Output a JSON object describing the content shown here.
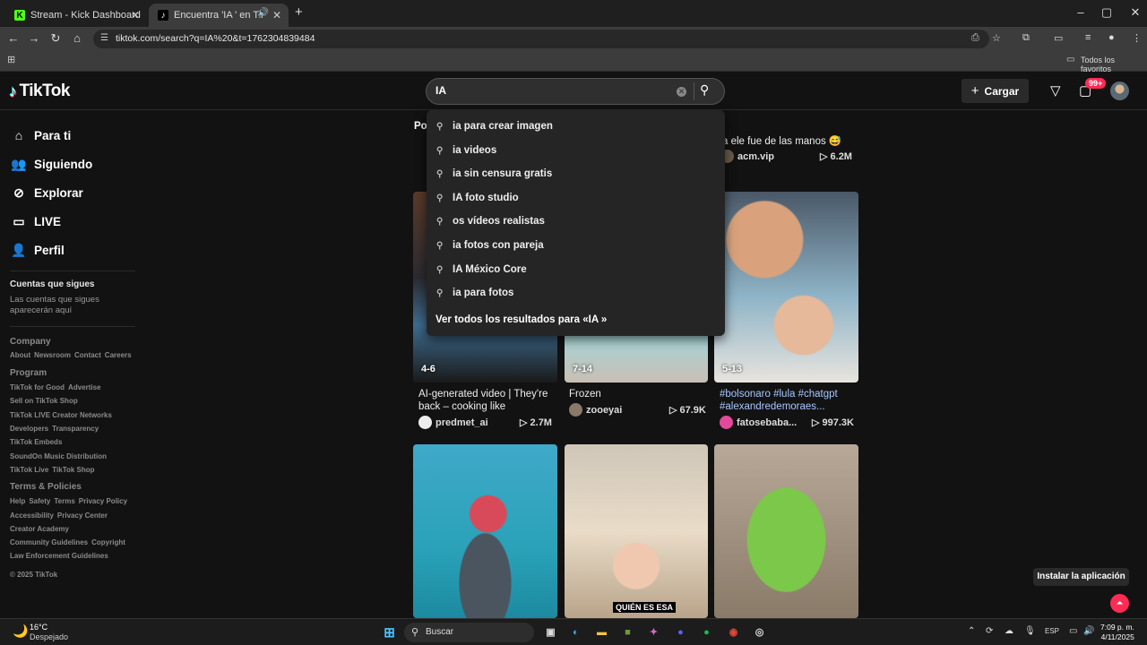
{
  "browser": {
    "tabs": [
      {
        "label": "Stream - Kick Dashboard",
        "favicon": "K"
      },
      {
        "label": "Encuentra 'IA ' en TikTok | B",
        "favicon": "♪"
      }
    ],
    "url": "tiktok.com/search?q=IA%20&t=1762304839484",
    "bookmarks_label": "Todos los favoritos"
  },
  "header": {
    "logo": "TikTok",
    "search_value": "IA",
    "upload_label": "Cargar",
    "inbox_badge": "99+"
  },
  "sidebar": {
    "nav": [
      {
        "label": "Para ti",
        "icon": "home-icon"
      },
      {
        "label": "Siguiendo",
        "icon": "following-icon"
      },
      {
        "label": "Explorar",
        "icon": "compass-icon"
      },
      {
        "label": "LIVE",
        "icon": "live-icon"
      },
      {
        "label": "Perfil",
        "icon": "profile-icon"
      }
    ],
    "following_title": "Cuentas que sigues",
    "following_text": "Las cuentas que sigues aparecerán aquí",
    "company_title": "Company",
    "company_links": [
      "About",
      "Newsroom",
      "Contact",
      "Careers"
    ],
    "program_title": "Program",
    "program_rows": [
      [
        "TikTok for Good",
        "Advertise"
      ],
      [
        "Sell on TikTok Shop"
      ],
      [
        "TikTok LIVE Creator Networks"
      ],
      [
        "Developers",
        "Transparency"
      ],
      [
        "TikTok Embeds"
      ],
      [
        "SoundOn Music Distribution"
      ],
      [
        "TikTok Live",
        "TikTok Shop"
      ]
    ],
    "terms_title": "Terms & Policies",
    "terms_rows": [
      [
        "Help",
        "Safety",
        "Terms",
        "Privacy Policy"
      ],
      [
        "Accessibility",
        "Privacy Center"
      ],
      [
        "Creator Academy"
      ],
      [
        "Community Guidelines",
        "Copyright"
      ],
      [
        "Law Enforcement Guidelines"
      ]
    ],
    "copyright": "© 2025 TikTok"
  },
  "suggestions": {
    "items": [
      "ia para crear imagen",
      "ia videos",
      "ia sin censura gratis",
      "IA foto studio",
      "os vídeos realistas",
      "ia fotos con pareja",
      "IA México Core",
      "ia para fotos"
    ],
    "see_all": "Ver todos los resultados para «IA »"
  },
  "videos": {
    "top_partial": {
      "left_caption_fragment": "Po",
      "right_caption": "a ele fue de las manos 😅",
      "right_author": "acm.vip",
      "right_views": "6.2M"
    },
    "row2": [
      {
        "count": "4-6",
        "caption": "AI-generated video | They're back – cooking like builders!...",
        "author": "predmet_ai",
        "views": "2.7M"
      },
      {
        "count": "7-14",
        "caption": "Frozen",
        "author": "zooeyai",
        "views": "67.9K"
      },
      {
        "count": "5-13",
        "caption": "#bolsonaro #lula #chatgpt #alexandredemoraes...",
        "author": "fatosebaba...",
        "views": "997.3K"
      }
    ],
    "row3_overlay_text": "QUIÉN ES ESA"
  },
  "install_label": "Instalar la aplicación",
  "taskbar": {
    "temp": "16°C",
    "condition": "Despejado",
    "search_label": "Buscar",
    "lang": "ESP",
    "time": "7:09 p. m.",
    "date": "4/11/2025"
  },
  "colors": {
    "accent": "#fe2c55",
    "tag": "#a9c7ff",
    "bg": "#121212"
  }
}
